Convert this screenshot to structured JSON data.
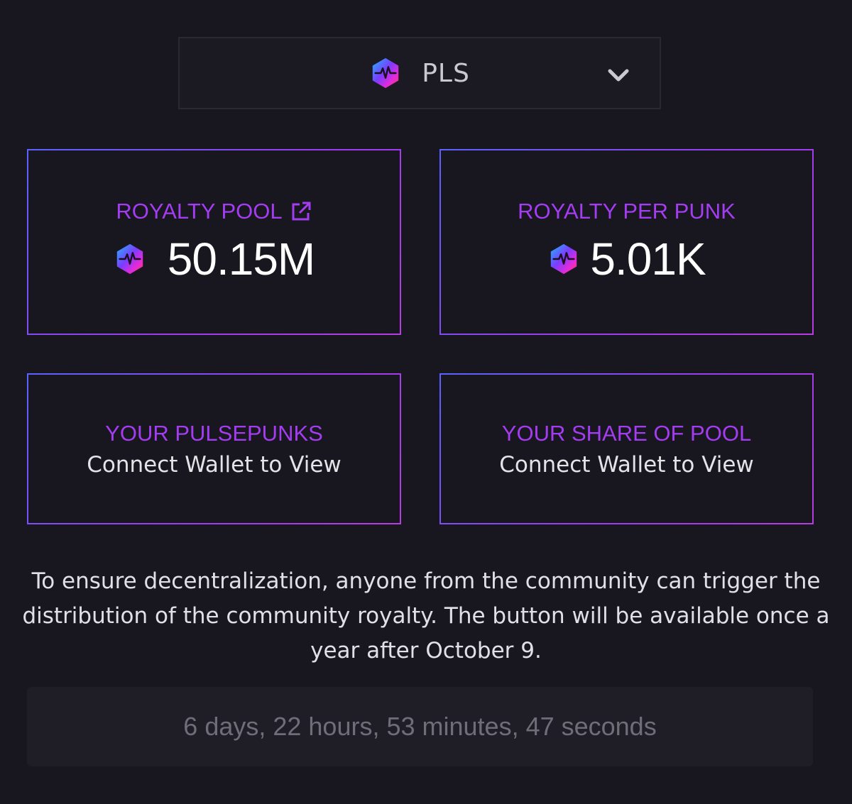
{
  "token_selector": {
    "label": "PLS",
    "logo_icon": "pulsechain-logo-icon",
    "chevron_icon": "chevron-down-icon"
  },
  "cards": {
    "royalty_pool": {
      "title": "ROYALTY POOL",
      "value": "50.15M",
      "link_icon": "external-link-icon"
    },
    "royalty_per_punk": {
      "title": "ROYALTY PER PUNK",
      "value": "5.01K"
    },
    "your_pulsepunks": {
      "title": "YOUR PULSEPUNKS",
      "value": "Connect Wallet to View"
    },
    "your_share": {
      "title": "YOUR SHARE OF POOL",
      "value": "Connect Wallet to View"
    }
  },
  "info_text": "To ensure decentralization, anyone from the community can trigger the distribution of the community royalty. The button will be available once a year after October 9.",
  "countdown": "6 days, 22 hours, 53 minutes, 47 seconds",
  "colors": {
    "background": "#18171f",
    "accent_purple": "#a43cf2",
    "border_gradient_start": "#5a63ff",
    "border_gradient_end": "#b63de0"
  }
}
